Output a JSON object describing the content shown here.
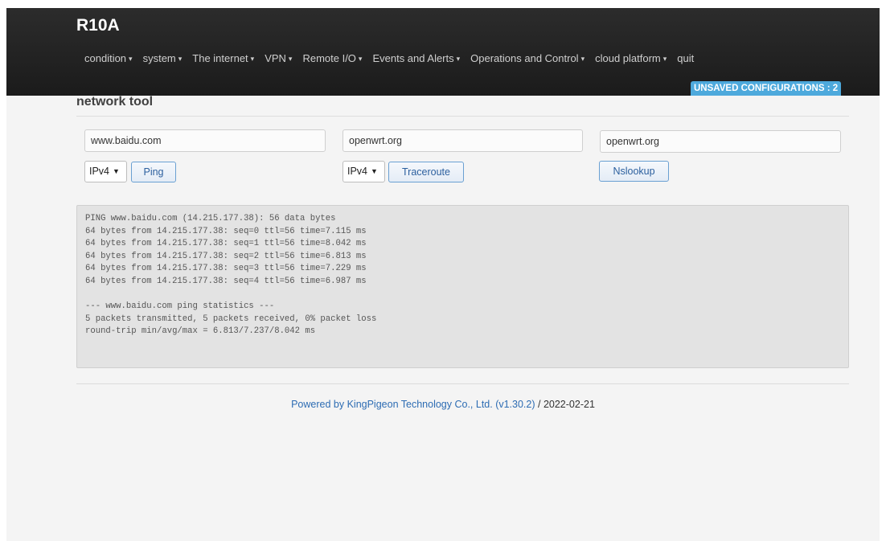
{
  "brand": "R10A",
  "menu": [
    {
      "label": "condition",
      "has_dropdown": true
    },
    {
      "label": "system",
      "has_dropdown": true
    },
    {
      "label": "The internet",
      "has_dropdown": true
    },
    {
      "label": "VPN",
      "has_dropdown": true
    },
    {
      "label": "Remote I/O",
      "has_dropdown": true
    },
    {
      "label": "Events and Alerts",
      "has_dropdown": true
    },
    {
      "label": "Operations and Control",
      "has_dropdown": true
    },
    {
      "label": "cloud platform",
      "has_dropdown": true
    },
    {
      "label": "quit",
      "has_dropdown": false
    }
  ],
  "badge": "UNSAVED CONFIGURATIONS : 2",
  "page_title": "network tool",
  "tools": {
    "ping": {
      "host": "www.baidu.com",
      "protocol": "IPv4",
      "button": "Ping"
    },
    "traceroute": {
      "host": "openwrt.org",
      "protocol": "IPv4",
      "button": "Traceroute"
    },
    "nslookup": {
      "host": "openwrt.org",
      "button": "Nslookup"
    }
  },
  "output": "PING www.baidu.com (14.215.177.38): 56 data bytes\n64 bytes from 14.215.177.38: seq=0 ttl=56 time=7.115 ms\n64 bytes from 14.215.177.38: seq=1 ttl=56 time=8.042 ms\n64 bytes from 14.215.177.38: seq=2 ttl=56 time=6.813 ms\n64 bytes from 14.215.177.38: seq=3 ttl=56 time=7.229 ms\n64 bytes from 14.215.177.38: seq=4 ttl=56 time=6.987 ms\n\n--- www.baidu.com ping statistics ---\n5 packets transmitted, 5 packets received, 0% packet loss\nround-trip min/avg/max = 6.813/7.237/8.042 ms",
  "footer": {
    "link_text": "Powered by KingPigeon Technology Co., Ltd. (v1.30.2)",
    "separator": " / ",
    "date": "2022-02-21"
  },
  "colors": {
    "navbar": "#1b1b1b",
    "badge": "#4da9dc",
    "link": "#2d6cb3",
    "output_bg": "#e3e3e3"
  }
}
